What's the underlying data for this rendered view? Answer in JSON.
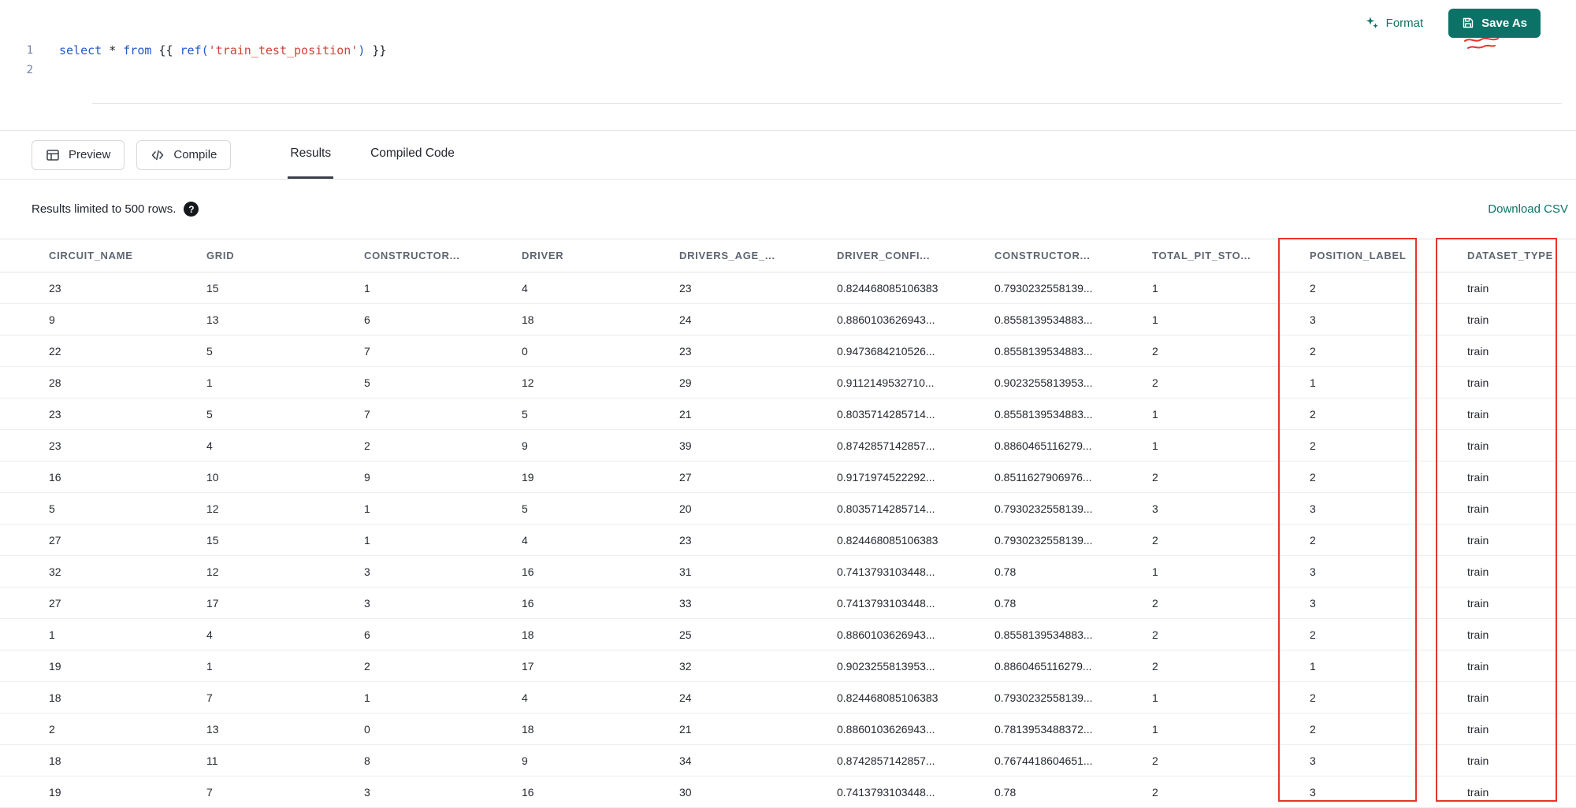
{
  "colors": {
    "accent": "#0c7267",
    "annotation": "#e8342c"
  },
  "toolbar": {
    "format": "Format",
    "save_as": "Save As"
  },
  "editor": {
    "line_numbers": [
      "1",
      "2"
    ],
    "tokens": [
      {
        "t": "select",
        "c": "kw"
      },
      {
        "t": " ",
        "c": "plain"
      },
      {
        "t": "*",
        "c": "op"
      },
      {
        "t": " ",
        "c": "plain"
      },
      {
        "t": "from",
        "c": "kw"
      },
      {
        "t": " {{ ",
        "c": "plain"
      },
      {
        "t": "ref(",
        "c": "fn"
      },
      {
        "t": "'train_test_position'",
        "c": "str"
      },
      {
        "t": ")",
        "c": "fn"
      },
      {
        "t": " }}",
        "c": "plain"
      }
    ]
  },
  "controls": {
    "preview": "Preview",
    "compile": "Compile"
  },
  "tabs": [
    {
      "label": "Results",
      "active": true
    },
    {
      "label": "Compiled Code",
      "active": false
    }
  ],
  "results_bar": {
    "info": "Results limited to 500 rows.",
    "help_icon": "?",
    "download": "Download CSV"
  },
  "table": {
    "columns": [
      "CIRCUIT_NAME",
      "GRID",
      "CONSTRUCTOR...",
      "DRIVER",
      "DRIVERS_AGE_...",
      "DRIVER_CONFI...",
      "CONSTRUCTOR...",
      "TOTAL_PIT_STO...",
      "POSITION_LABEL",
      "DATASET_TYPE"
    ],
    "highlighted_columns": [
      "POSITION_LABEL",
      "DATASET_TYPE"
    ],
    "rows": [
      [
        "23",
        "15",
        "1",
        "4",
        "23",
        "0.824468085106383",
        "0.7930232558139...",
        "1",
        "2",
        "train"
      ],
      [
        "9",
        "13",
        "6",
        "18",
        "24",
        "0.8860103626943...",
        "0.8558139534883...",
        "1",
        "3",
        "train"
      ],
      [
        "22",
        "5",
        "7",
        "0",
        "23",
        "0.9473684210526...",
        "0.8558139534883...",
        "2",
        "2",
        "train"
      ],
      [
        "28",
        "1",
        "5",
        "12",
        "29",
        "0.9112149532710...",
        "0.9023255813953...",
        "2",
        "1",
        "train"
      ],
      [
        "23",
        "5",
        "7",
        "5",
        "21",
        "0.8035714285714...",
        "0.8558139534883...",
        "1",
        "2",
        "train"
      ],
      [
        "23",
        "4",
        "2",
        "9",
        "39",
        "0.8742857142857...",
        "0.8860465116279...",
        "1",
        "2",
        "train"
      ],
      [
        "16",
        "10",
        "9",
        "19",
        "27",
        "0.9171974522292...",
        "0.8511627906976...",
        "2",
        "2",
        "train"
      ],
      [
        "5",
        "12",
        "1",
        "5",
        "20",
        "0.8035714285714...",
        "0.7930232558139...",
        "3",
        "3",
        "train"
      ],
      [
        "27",
        "15",
        "1",
        "4",
        "23",
        "0.824468085106383",
        "0.7930232558139...",
        "2",
        "2",
        "train"
      ],
      [
        "32",
        "12",
        "3",
        "16",
        "31",
        "0.7413793103448...",
        "0.78",
        "1",
        "3",
        "train"
      ],
      [
        "27",
        "17",
        "3",
        "16",
        "33",
        "0.7413793103448...",
        "0.78",
        "2",
        "3",
        "train"
      ],
      [
        "1",
        "4",
        "6",
        "18",
        "25",
        "0.8860103626943...",
        "0.8558139534883...",
        "2",
        "2",
        "train"
      ],
      [
        "19",
        "1",
        "2",
        "17",
        "32",
        "0.9023255813953...",
        "0.8860465116279...",
        "2",
        "1",
        "train"
      ],
      [
        "18",
        "7",
        "1",
        "4",
        "24",
        "0.824468085106383",
        "0.7930232558139...",
        "1",
        "2",
        "train"
      ],
      [
        "2",
        "13",
        "0",
        "18",
        "21",
        "0.8860103626943...",
        "0.7813953488372...",
        "1",
        "2",
        "train"
      ],
      [
        "18",
        "11",
        "8",
        "9",
        "34",
        "0.8742857142857...",
        "0.7674418604651...",
        "2",
        "3",
        "train"
      ],
      [
        "19",
        "7",
        "3",
        "16",
        "30",
        "0.7413793103448...",
        "0.78",
        "2",
        "3",
        "train"
      ]
    ]
  }
}
